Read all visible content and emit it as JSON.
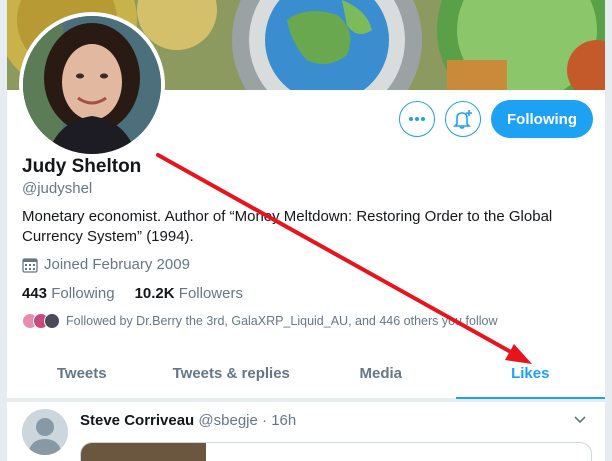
{
  "profile": {
    "name": "Judy Shelton",
    "handle": "@judyshel",
    "bio": "Monetary economist. Author of “Money Meltdown: Restoring Order to the Global Currency System” (1994).",
    "joined": "Joined February 2009",
    "following_count": "443",
    "following_label": "Following",
    "followers_count": "10.2K",
    "followers_label": "Followers",
    "followed_by": "Followed by Dr.Berry the 3rd, GalaXRP_Liquid_AU, and 446 others you follow"
  },
  "actions": {
    "more_icon": "more-dots-icon",
    "notify_icon": "bell-plus-icon",
    "follow_label": "Following"
  },
  "tabs": [
    {
      "label": "Tweets",
      "active": false
    },
    {
      "label": "Tweets & replies",
      "active": false
    },
    {
      "label": "Media",
      "active": false
    },
    {
      "label": "Likes",
      "active": true
    }
  ],
  "tweet": {
    "author": "Steve Corriveau",
    "handle": "@sbegje",
    "separator": "·",
    "time": "16h"
  },
  "colors": {
    "accent": "#1da1f2",
    "annotation_arrow": "#e8141c"
  }
}
